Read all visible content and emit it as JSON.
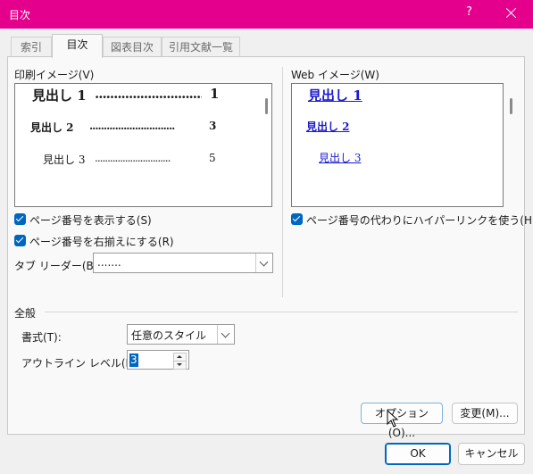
{
  "window": {
    "title": "目次",
    "help_label": "?"
  },
  "tabs": [
    {
      "label": "索引"
    },
    {
      "label": "目次"
    },
    {
      "label": "図表目次"
    },
    {
      "label": "引用文献一覧"
    }
  ],
  "print_preview": {
    "label": "印刷イメージ(V)",
    "lines": [
      {
        "text": "見出し 1",
        "leader": "..............................",
        "page": "1"
      },
      {
        "text": "見出し 2",
        "leader": "..............................",
        "page": "3"
      },
      {
        "text": "見出し 3",
        "leader": "..............................",
        "page": "5"
      }
    ]
  },
  "web_preview": {
    "label": "Web イメージ(W)",
    "lines": [
      "見出し 1",
      "見出し 2",
      "見出し 3"
    ]
  },
  "options": {
    "show_page_numbers": {
      "label": "ページ番号を表示する(S)",
      "checked": true
    },
    "right_align": {
      "label": "ページ番号を右揃えにする(R)",
      "checked": true
    },
    "hyperlinks": {
      "label": "ページ番号の代わりにハイパーリンクを使う(H)",
      "checked": true
    },
    "tab_leader": {
      "label": "タブ リーダー(B):",
      "value": "......."
    }
  },
  "general": {
    "heading": "全般",
    "format": {
      "label": "書式(T):",
      "value": "任意のスタイル"
    },
    "outline_level": {
      "label": "アウトライン レベル(L):",
      "value": "3"
    }
  },
  "buttons": {
    "options": "オプション(O)...",
    "modify": "変更(M)...",
    "ok": "OK",
    "cancel": "キャンセル"
  },
  "colors": {
    "titlebar": "#e4008c",
    "accent": "#0067c0",
    "link": "#1a1ad0"
  }
}
